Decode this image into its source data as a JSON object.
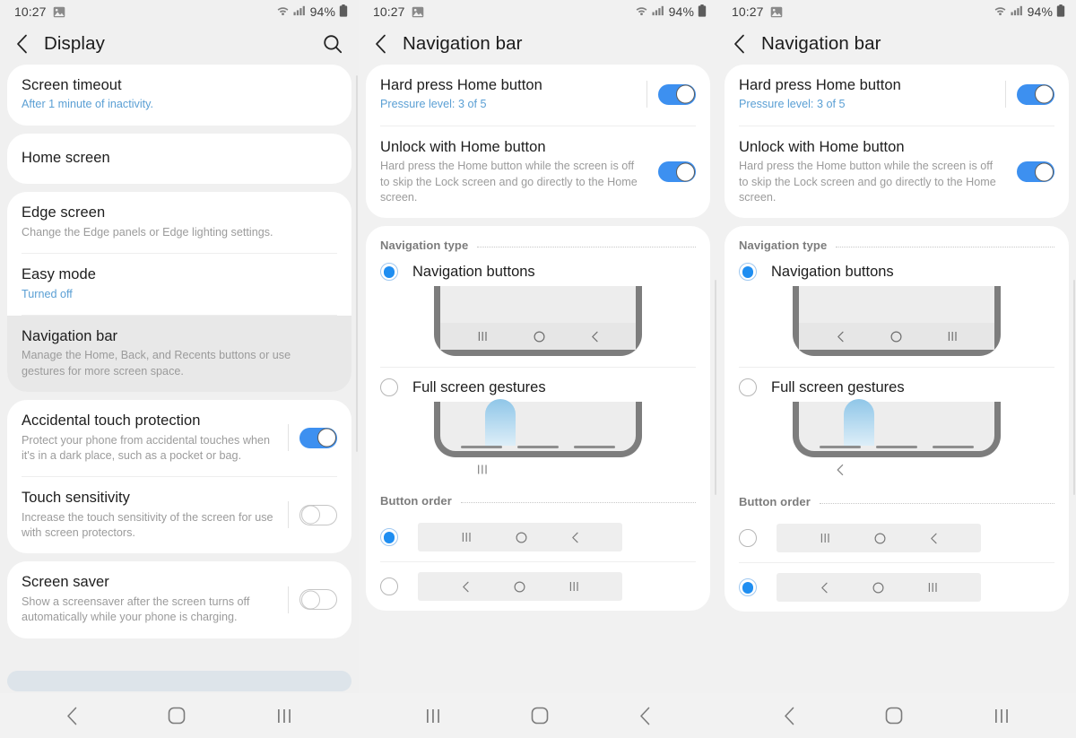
{
  "status": {
    "time": "10:27",
    "gallery_icon": "image-icon",
    "wifi_icon": "wifi-icon",
    "signal_icon": "cellular-signal-icon",
    "battery_percent": "94%",
    "battery_icon": "battery-icon"
  },
  "panel1": {
    "appbar": {
      "back_icon": "back-chevron-icon",
      "title": "Display",
      "search_icon": "search-icon"
    },
    "items": [
      {
        "title": "Screen timeout",
        "sub": "After 1 minute of inactivity.",
        "sub_style": "accent"
      },
      {
        "title": "Home screen",
        "sub": ""
      },
      {
        "title": "Edge screen",
        "sub": "Change the Edge panels or Edge lighting settings."
      },
      {
        "title": "Easy mode",
        "sub": "Turned off",
        "sub_style": "accent"
      },
      {
        "title": "Navigation bar",
        "sub": "Manage the Home, Back, and Recents buttons or use gestures for more screen space."
      },
      {
        "title": "Accidental touch protection",
        "sub": "Protect your phone from accidental touches when it's in a dark place, such as a pocket or bag.",
        "toggle": "on"
      },
      {
        "title": "Touch sensitivity",
        "sub": "Increase the touch sensitivity of the screen for use with screen protectors.",
        "toggle": "off"
      },
      {
        "title": "Screen saver",
        "sub": "Show a screensaver after the screen turns off automatically while your phone is charging.",
        "toggle": "off"
      }
    ],
    "sysnav": [
      "back-chevron-icon",
      "home-square-icon",
      "recents-bars-icon"
    ]
  },
  "panel2": {
    "appbar": {
      "back_icon": "back-chevron-icon",
      "title": "Navigation bar"
    },
    "home_items": [
      {
        "title": "Hard press Home button",
        "sub": "Pressure level: 3 of 5",
        "sub_style": "accent",
        "toggle": "on"
      },
      {
        "title": "Unlock with Home button",
        "sub": "Hard press the Home button while the screen is off to skip the Lock screen and go directly to the Home screen.",
        "toggle": "on"
      }
    ],
    "nav_type": {
      "header": "Navigation type",
      "options": [
        {
          "label": "Navigation buttons",
          "selected": true,
          "preview_glyphs": [
            "recents-bars-icon",
            "home-circle-icon",
            "back-chevron-icon"
          ]
        },
        {
          "label": "Full screen gestures",
          "selected": false,
          "caption_glyph": "recents-bars-icon"
        }
      ]
    },
    "button_order": {
      "header": "Button order",
      "options": [
        {
          "selected": true,
          "glyphs": [
            "recents-bars-icon",
            "home-circle-icon",
            "back-chevron-icon"
          ]
        },
        {
          "selected": false,
          "glyphs": [
            "back-chevron-icon",
            "home-circle-icon",
            "recents-bars-icon"
          ]
        }
      ]
    },
    "sysnav": [
      "recents-bars-icon",
      "home-square-icon",
      "back-chevron-icon"
    ]
  },
  "panel3": {
    "appbar": {
      "back_icon": "back-chevron-icon",
      "title": "Navigation bar"
    },
    "home_items": [
      {
        "title": "Hard press Home button",
        "sub": "Pressure level: 3 of 5",
        "sub_style": "accent",
        "toggle": "on"
      },
      {
        "title": "Unlock with Home button",
        "sub": "Hard press the Home button while the screen is off to skip the Lock screen and go directly to the Home screen.",
        "toggle": "on"
      }
    ],
    "nav_type": {
      "header": "Navigation type",
      "options": [
        {
          "label": "Navigation buttons",
          "selected": true,
          "preview_glyphs": [
            "back-chevron-icon",
            "home-circle-icon",
            "recents-bars-icon"
          ]
        },
        {
          "label": "Full screen gestures",
          "selected": false,
          "caption_glyph": "back-chevron-icon"
        }
      ]
    },
    "button_order": {
      "header": "Button order",
      "options": [
        {
          "selected": false,
          "glyphs": [
            "recents-bars-icon",
            "home-circle-icon",
            "back-chevron-icon"
          ]
        },
        {
          "selected": true,
          "glyphs": [
            "back-chevron-icon",
            "home-circle-icon",
            "recents-bars-icon"
          ]
        }
      ]
    },
    "sysnav": [
      "back-chevron-icon",
      "home-square-icon",
      "recents-bars-icon"
    ]
  },
  "colors": {
    "accent_blue": "#5a9fd4",
    "toggle_on": "#3d90f0",
    "radio_on": "#1f8ef1",
    "page_bg": "#f1f1f1",
    "card_bg": "#ffffff",
    "bottom_bar": "#dde4ea"
  }
}
